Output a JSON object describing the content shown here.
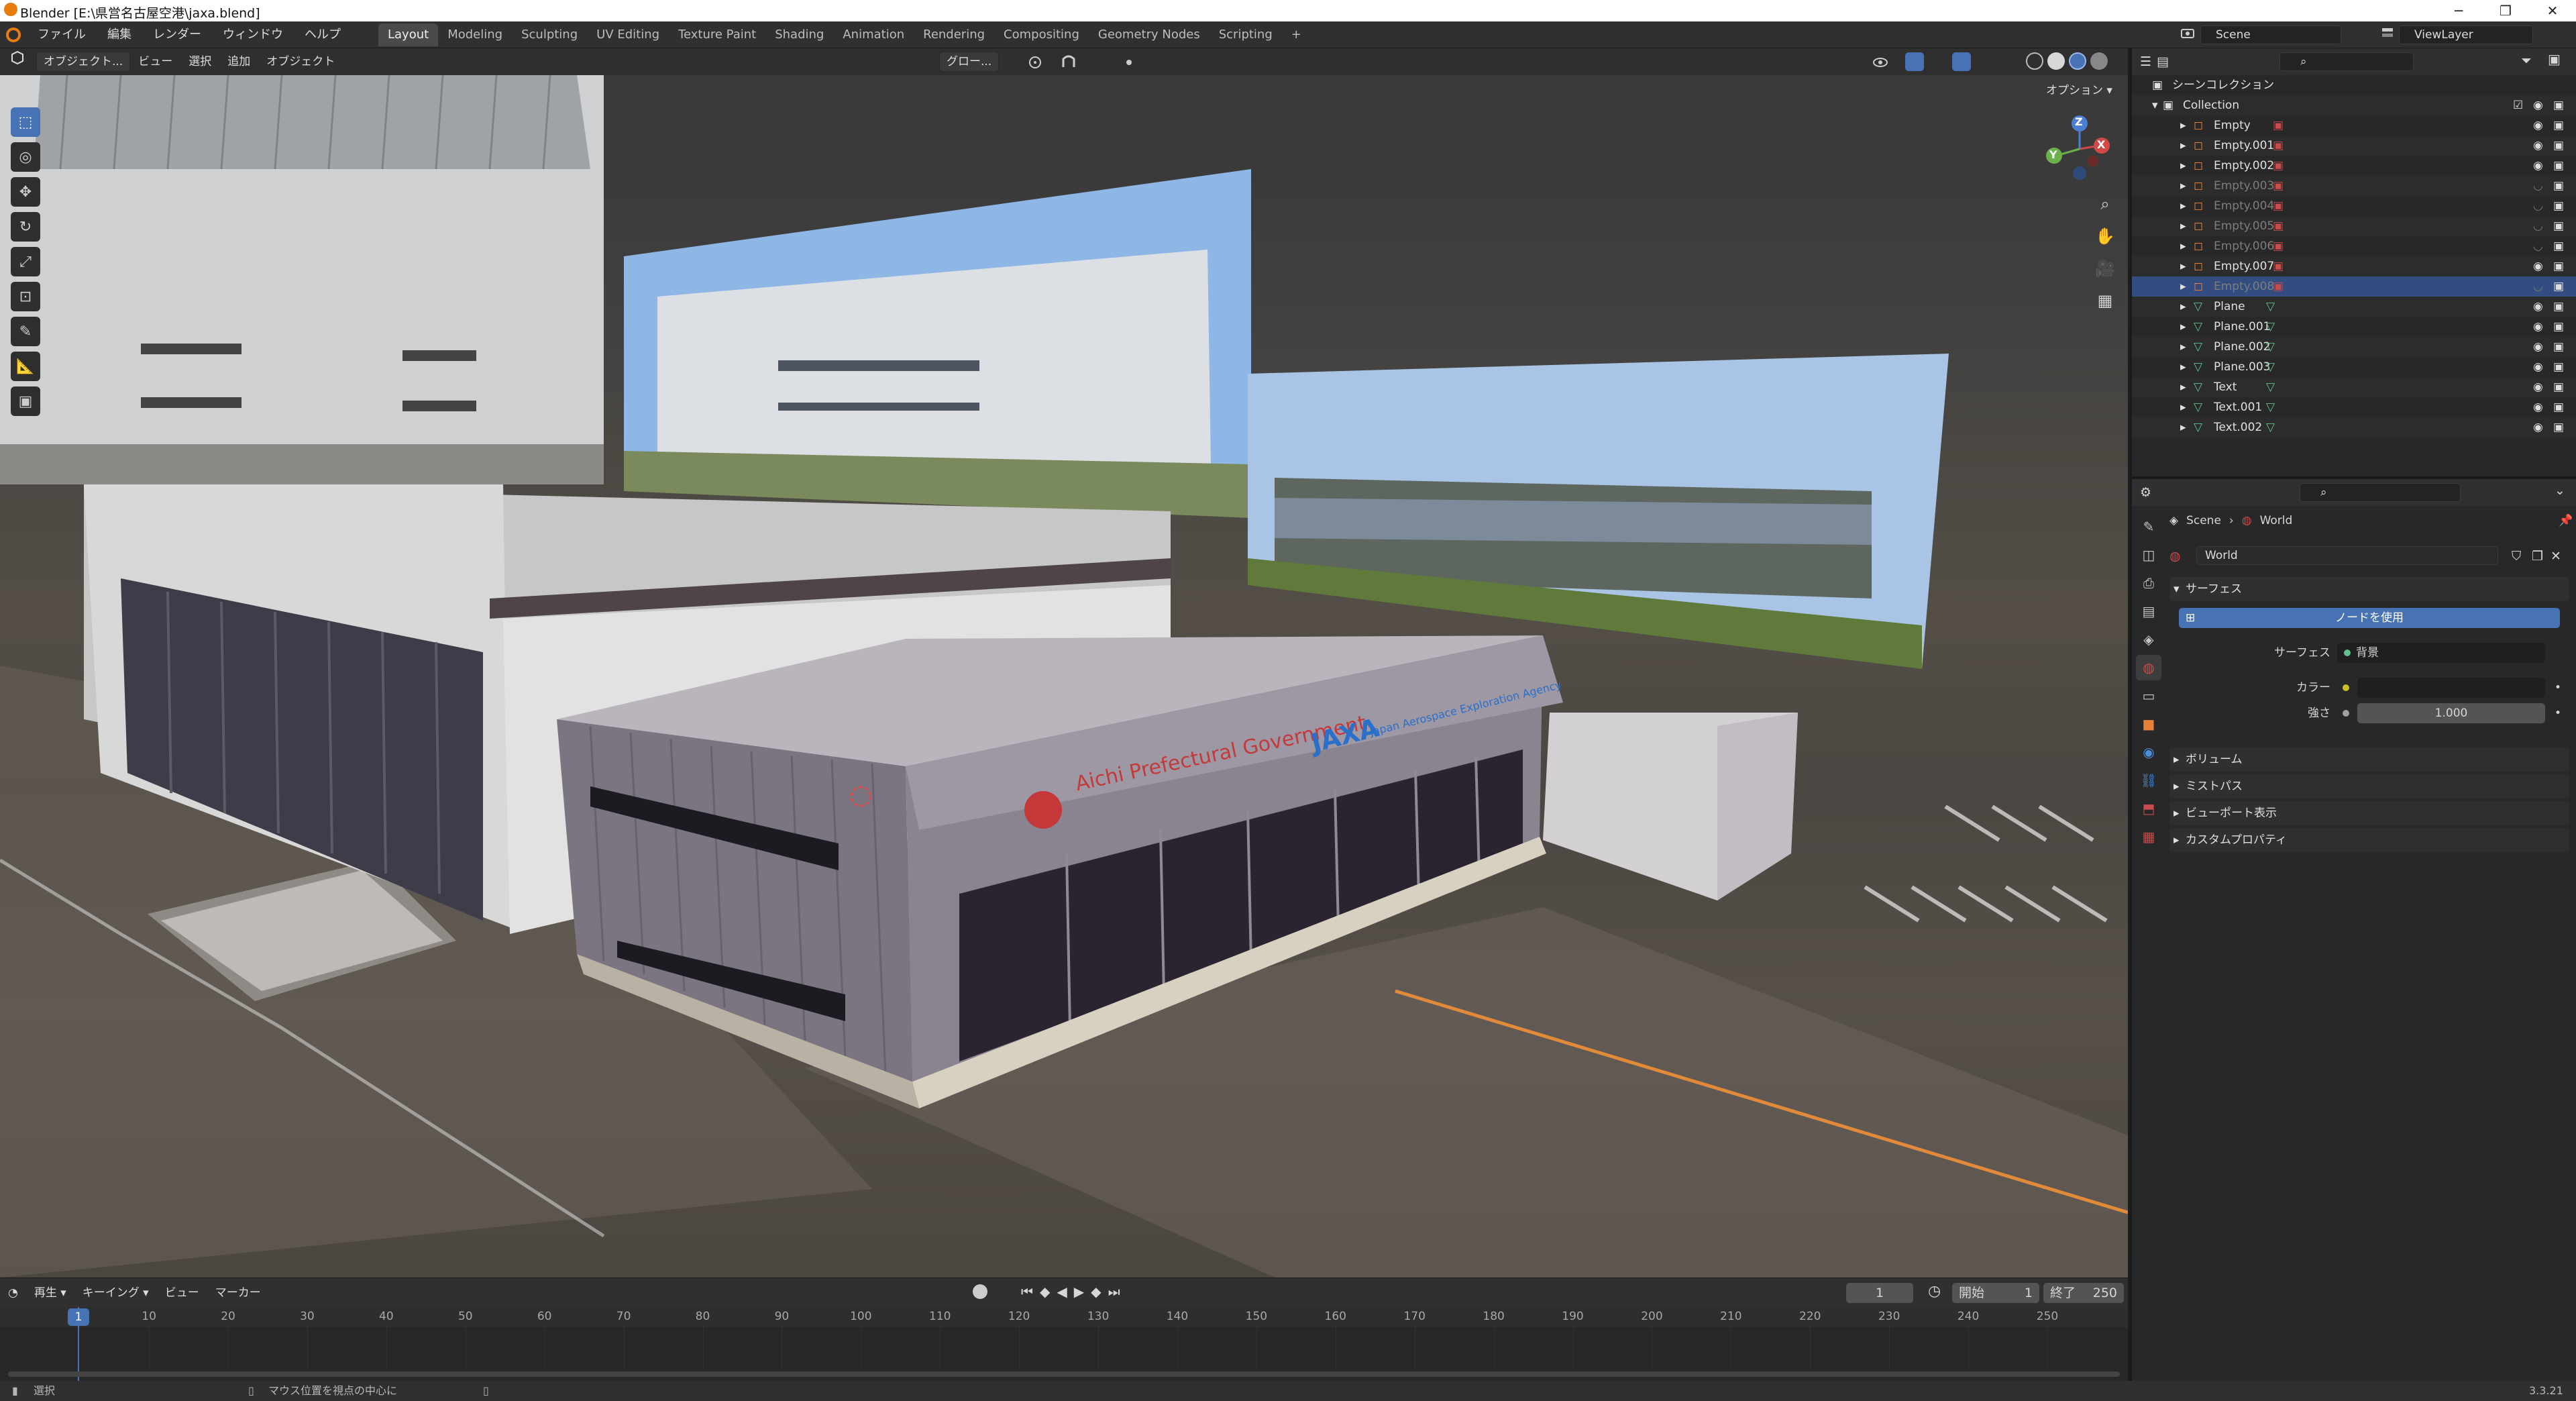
{
  "window": {
    "title": "Blender [E:\\県営名古屋空港\\jaxa.blend]",
    "minimize": "─",
    "maximize": "❐",
    "close": "✕"
  },
  "menu": {
    "items": [
      "ファイル",
      "編集",
      "レンダー",
      "ウィンドウ",
      "ヘルプ"
    ],
    "workspaces": [
      "Layout",
      "Modeling",
      "Sculpting",
      "UV Editing",
      "Texture Paint",
      "Shading",
      "Animation",
      "Rendering",
      "Compositing",
      "Geometry Nodes",
      "Scripting"
    ],
    "add_workspace": "+",
    "scene": "Scene",
    "view_layer": "ViewLayer"
  },
  "viewport": {
    "mode": "オブジェクト...",
    "menus": [
      "ビュー",
      "選択",
      "追加",
      "オブジェクト"
    ],
    "transform": "グロー...",
    "options": "オプション ▾",
    "gizmo": {
      "x": "X",
      "y": "Y",
      "z": "Z"
    },
    "signage": {
      "aichi": "Aichi Prefectural Government",
      "jaxa": "JAXA",
      "jaxa_sub": "Japan Aerospace Exploration Agency"
    }
  },
  "timeline": {
    "menus": [
      "再生 ▾",
      "キーイング ▾",
      "ビュー",
      "マーカー"
    ],
    "current_frame": "1",
    "start_label": "開始",
    "start": "1",
    "end_label": "終了",
    "end": "250",
    "ticks": [
      "1",
      "10",
      "20",
      "30",
      "40",
      "50",
      "60",
      "70",
      "80",
      "90",
      "100",
      "110",
      "120",
      "130",
      "140",
      "150",
      "160",
      "170",
      "180",
      "190",
      "200",
      "210",
      "220",
      "230",
      "240",
      "250"
    ]
  },
  "status": {
    "select": "選択",
    "center": "マウス位置を視点の中心に",
    "version": "3.3.21"
  },
  "outliner": {
    "root": "シーンコレクション",
    "collection": "Collection",
    "rows": [
      {
        "name": "Empty",
        "type": "empty",
        "dim": false,
        "selected": false
      },
      {
        "name": "Empty.001",
        "type": "empty",
        "dim": false,
        "selected": false
      },
      {
        "name": "Empty.002",
        "type": "empty",
        "dim": false,
        "selected": false
      },
      {
        "name": "Empty.003",
        "type": "empty",
        "dim": true,
        "selected": false
      },
      {
        "name": "Empty.004",
        "type": "empty",
        "dim": true,
        "selected": false
      },
      {
        "name": "Empty.005",
        "type": "empty",
        "dim": true,
        "selected": false
      },
      {
        "name": "Empty.006",
        "type": "empty",
        "dim": true,
        "selected": false
      },
      {
        "name": "Empty.007",
        "type": "empty",
        "dim": false,
        "selected": false
      },
      {
        "name": "Empty.008",
        "type": "empty",
        "dim": true,
        "selected": true
      },
      {
        "name": "Plane",
        "type": "mesh",
        "dim": false,
        "selected": false
      },
      {
        "name": "Plane.001",
        "type": "mesh",
        "dim": false,
        "selected": false
      },
      {
        "name": "Plane.002",
        "type": "mesh",
        "dim": false,
        "selected": false
      },
      {
        "name": "Plane.003",
        "type": "mesh",
        "dim": false,
        "selected": false
      },
      {
        "name": "Text",
        "type": "mesh",
        "dim": false,
        "selected": false
      },
      {
        "name": "Text.001",
        "type": "mesh",
        "dim": false,
        "selected": false
      },
      {
        "name": "Text.002",
        "type": "mesh",
        "dim": false,
        "selected": false
      }
    ]
  },
  "properties": {
    "breadcrumb_scene": "Scene",
    "breadcrumb_world": "World",
    "world_name": "World",
    "surface_panel": "サーフェス",
    "use_nodes": "ノードを使用",
    "surface_label": "サーフェス",
    "surface_value": "背景",
    "color_label": "カラー",
    "strength_label": "強さ",
    "strength_value": "1.000",
    "panels": [
      "ボリューム",
      "ミストパス",
      "ビューポート表示",
      "カスタムプロパティ"
    ]
  },
  "colors": {
    "accent": "#4772b3",
    "selected_row": "#334d80",
    "empty_icon": "#e8803a",
    "mesh_icon": "#63c28c",
    "world_icon": "#c94b4b"
  }
}
